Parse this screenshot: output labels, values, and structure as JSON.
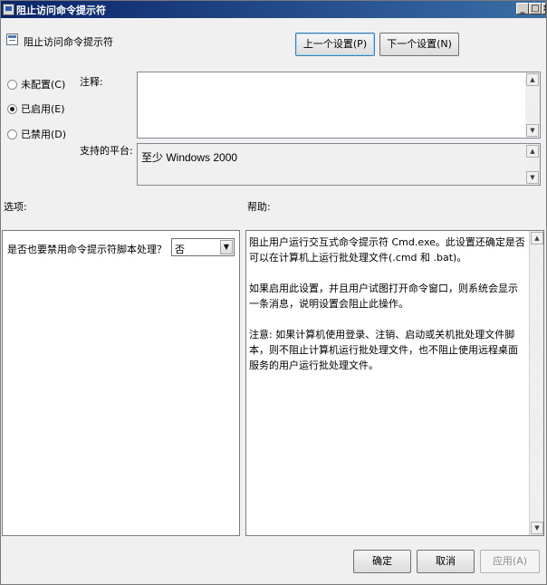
{
  "window": {
    "title": "阻止访问命令提示符",
    "min_label": "_",
    "max_label": "□",
    "close_label": "×"
  },
  "header": {
    "policy_name": "阻止访问命令提示符",
    "prev_button": "上一个设置(P)",
    "next_button": "下一个设置(N)"
  },
  "state": {
    "options": [
      {
        "label": "未配置(C)",
        "selected": false
      },
      {
        "label": "已启用(E)",
        "selected": true
      },
      {
        "label": "已禁用(D)",
        "selected": false
      }
    ]
  },
  "comment": {
    "label": "注释:",
    "value": ""
  },
  "platform": {
    "label": "支持的平台:",
    "value": "至少 Windows 2000"
  },
  "options_section": {
    "label": "选项:",
    "setting_label": "是否也要禁用命令提示符脚本处理？",
    "setting_value": "否"
  },
  "help_section": {
    "label": "帮助:",
    "paragraphs": [
      "阻止用户运行交互式命令提示符 Cmd.exe。此设置还确定是否可以在计算机上运行批处理文件(.cmd 和 .bat)。",
      "如果启用此设置，并且用户试图打开命令窗口，则系统会显示一条消息，说明设置会阻止此操作。",
      "注意: 如果计算机使用登录、注销、启动或关机批处理文件脚本，则不阻止计算机运行批处理文件，也不阻止使用远程桌面服务的用户运行批处理文件。"
    ]
  },
  "footer": {
    "ok": "确定",
    "cancel": "取消",
    "apply": "应用(A)"
  },
  "icons": {
    "policy": "policy-document-icon",
    "scroll_up": "scroll-up-arrow-icon",
    "scroll_down": "scroll-down-arrow-icon",
    "dropdown": "chevron-down-icon"
  }
}
